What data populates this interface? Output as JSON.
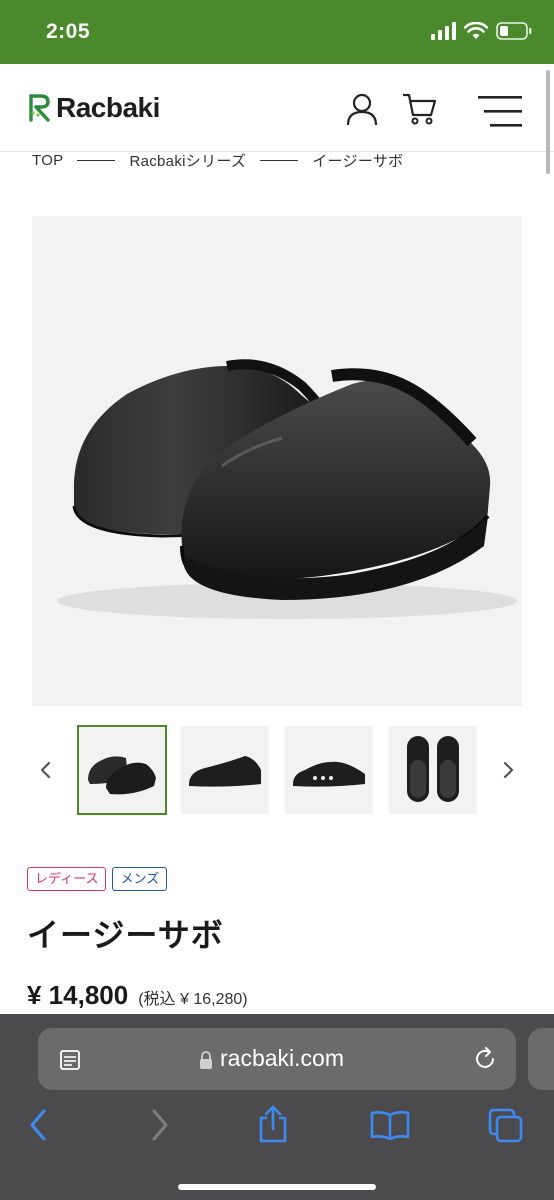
{
  "status_bar": {
    "time": "2:05",
    "background_color": "#4a8a2c",
    "icons": [
      "signal-icon",
      "wifi-icon",
      "battery-icon"
    ]
  },
  "header": {
    "logo_text": "Racbaki",
    "logo_mark": "R",
    "icons": [
      "user-icon",
      "cart-icon",
      "menu-icon"
    ]
  },
  "breadcrumb": {
    "items": [
      "TOP",
      "Racbakiシリーズ",
      "イージーサボ"
    ]
  },
  "product": {
    "tags": [
      "レディース",
      "メンズ"
    ],
    "title": "イージーサボ",
    "price": "¥ 14,800",
    "price_tax": "(税込 ¥ 16,280)",
    "thumbnail_count": 4,
    "active_thumbnail": 1
  },
  "safari": {
    "url": "racbaki.com",
    "toolbar_icons": [
      "back-icon",
      "forward-icon",
      "share-icon",
      "bookmarks-icon",
      "tabs-icon"
    ]
  },
  "colors": {
    "brand_green": "#4a8a2c",
    "tag_ladies": "#e0336e",
    "tag_mens": "#1f5a9c"
  }
}
